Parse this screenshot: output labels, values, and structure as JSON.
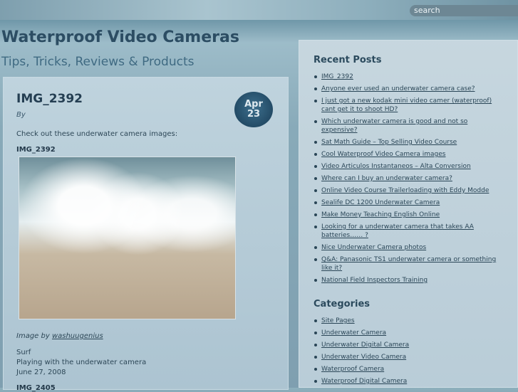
{
  "header": {
    "search_placeholder": "search",
    "site_title": "Waterproof Video Cameras",
    "tagline": "Tips, Tricks, Reviews & Products"
  },
  "post": {
    "title": "IMG_2392",
    "byline": "By",
    "date_month": "Apr",
    "date_day": "23",
    "intro": "Check out these underwater camera images:",
    "image_title": "IMG_2392",
    "credit_prefix": "Image by ",
    "credit_link": "washuugenius",
    "desc_lines": [
      "Surf",
      "Playing with the underwater camera",
      "June 27, 2008"
    ],
    "next_title": "IMG_2405"
  },
  "sidebar": {
    "recent_title": "Recent Posts",
    "recent": [
      "IMG_2392",
      "Anyone ever used an underwater camera case?",
      "I just got a new kodak mini video camer (waterproof) cant get it to shoot HD?",
      "Which underwater camera is good and not so expensive?",
      "Sat Math Guide – Top Selling Video Course",
      "Cool Waterproof Video Camera images",
      "Video Articulos Instantaneos – Alta Conversion",
      "Where can I buy an underwater camera?",
      "Online Video Course Trailerloading with Eddy Modde",
      "Sealife DC 1200 Underwater Camera",
      "Make Money Teaching English Online",
      "Looking for a underwater camera that takes AA batteries…… ?",
      "Nice Underwater Camera photos",
      "Q&A: Panasonic TS1 underwater camera or something like it?",
      "National Field Inspectors Training"
    ],
    "categories_title": "Categories",
    "categories": [
      "Site Pages",
      "Underwater Camera",
      "Underwater Digital Camera",
      "Underwater Video Camera",
      "Waterproof Camera",
      "Waterproof Digital Camera"
    ]
  }
}
